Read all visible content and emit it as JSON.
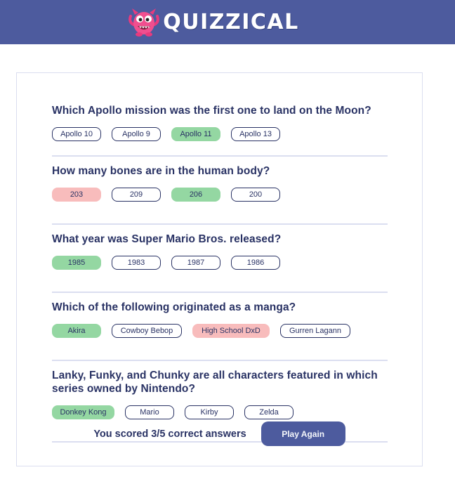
{
  "header": {
    "brand": "QUIZZICAL",
    "mascot_icon": "monster-mascot-icon",
    "background": "#4d5b9e"
  },
  "quiz": {
    "questions": [
      {
        "text": "Which Apollo mission was the first one to land on the Moon?",
        "answers": [
          {
            "label": "Apollo 10",
            "state": "neutral"
          },
          {
            "label": "Apollo 9",
            "state": "neutral"
          },
          {
            "label": "Apollo 11",
            "state": "correct"
          },
          {
            "label": "Apollo 13",
            "state": "neutral"
          }
        ]
      },
      {
        "text": "How many bones are in the human body?",
        "answers": [
          {
            "label": "203",
            "state": "wrong"
          },
          {
            "label": "209",
            "state": "neutral"
          },
          {
            "label": "206",
            "state": "correct"
          },
          {
            "label": "200",
            "state": "neutral"
          }
        ]
      },
      {
        "text": "What year was Super Mario Bros. released?",
        "answers": [
          {
            "label": "1985",
            "state": "correct"
          },
          {
            "label": "1983",
            "state": "neutral"
          },
          {
            "label": "1987",
            "state": "neutral"
          },
          {
            "label": "1986",
            "state": "neutral"
          }
        ]
      },
      {
        "text": "Which of the following originated as a manga?",
        "answers": [
          {
            "label": "Akira",
            "state": "correct"
          },
          {
            "label": "Cowboy Bebop",
            "state": "neutral"
          },
          {
            "label": "High School DxD",
            "state": "wrong"
          },
          {
            "label": "Gurren Lagann",
            "state": "neutral"
          }
        ]
      },
      {
        "text": "Lanky, Funky, and Chunky are all characters featured in which series owned by Nintendo?",
        "answers": [
          {
            "label": "Donkey Kong",
            "state": "correct"
          },
          {
            "label": "Mario",
            "state": "neutral"
          },
          {
            "label": "Kirby",
            "state": "neutral"
          },
          {
            "label": "Zelda",
            "state": "neutral"
          }
        ]
      }
    ],
    "score_text": "You scored 3/5 correct answers",
    "play_again_label": "Play Again"
  },
  "colors": {
    "correct": "#94d7a2",
    "wrong": "#f8bcbc",
    "text": "#293264",
    "accent": "#4d5b9e"
  }
}
